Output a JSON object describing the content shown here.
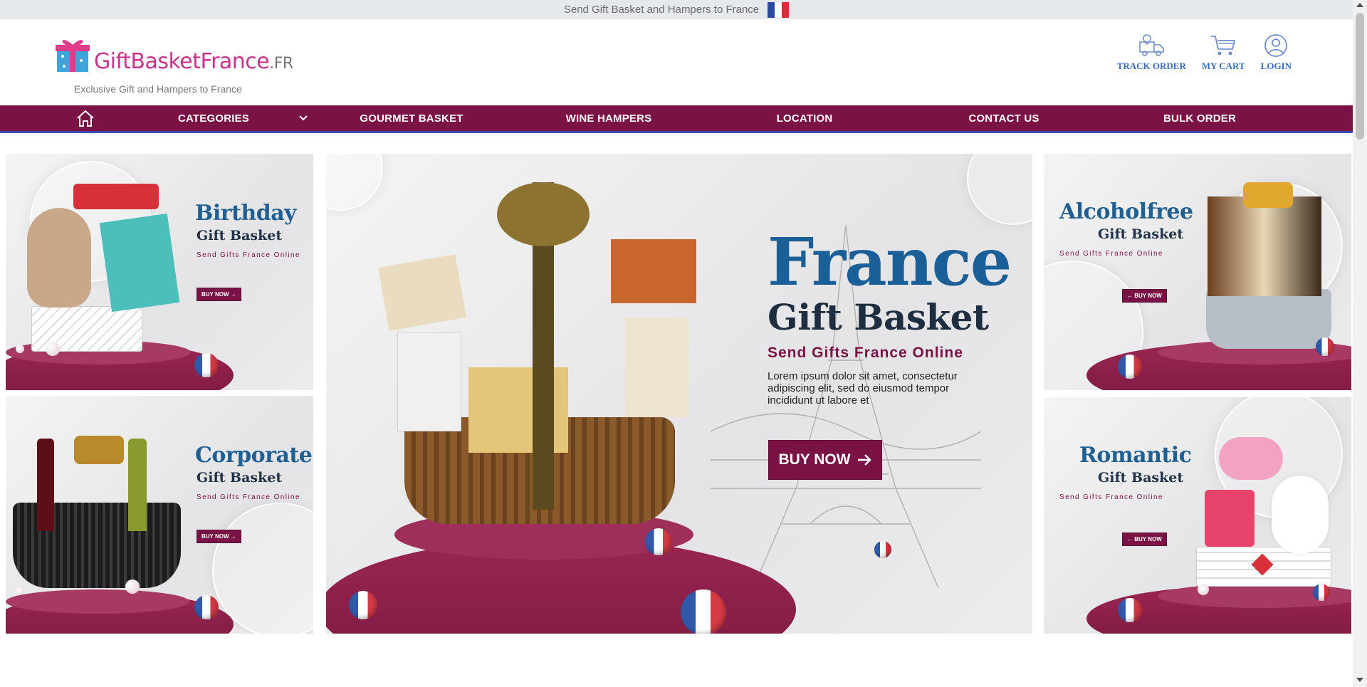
{
  "topbar": {
    "text": "Send Gift Basket and Hampers to France",
    "flag_colors": [
      "#2a49a0",
      "#ffffff",
      "#d8303a"
    ]
  },
  "header": {
    "logo_main": "GiftBasketFrance",
    "logo_suffix": ".FR",
    "tagline": "Exclusive Gift and Hampers to France",
    "icons": [
      {
        "label": "TRACK ORDER",
        "icon": "truck-icon"
      },
      {
        "label": "MY CART",
        "icon": "cart-icon"
      },
      {
        "label": "LOGIN",
        "icon": "user-icon"
      }
    ]
  },
  "nav": {
    "home_icon": "home-icon",
    "items": [
      "CATEGORIES",
      "GOURMET BASKET",
      "WINE HAMPERS",
      "LOCATION",
      "CONTACT US",
      "BULK ORDER"
    ]
  },
  "banners": {
    "birthday": {
      "title": "Birthday",
      "subtitle": "Gift Basket",
      "tagline": "Send Gifts France Online",
      "button": "BUY NOW"
    },
    "corporate": {
      "title": "Corporate",
      "subtitle": "Gift Basket",
      "tagline": "Send Gifts France Online",
      "button": "BUY NOW"
    },
    "alcoholfree": {
      "title": "Alcoholfree",
      "subtitle": "Gift Basket",
      "tagline": "Send Gifts France Online",
      "button": "BUY NOW"
    },
    "romantic": {
      "title": "Romantic",
      "subtitle": "Gift Basket",
      "tagline": "Send Gifts France Online",
      "button": "BUY NOW"
    },
    "hero": {
      "title": "France",
      "subtitle": "Gift Basket",
      "tagline": "Send Gifts France Online",
      "description": "Lorem ipsum dolor sit amet, consectetur adipiscing elit, sed do eiusmod tempor incididunt ut labore et",
      "button": "BUY NOW"
    }
  },
  "colors": {
    "brand": "#7b1246",
    "title_blue": "#1a5f97",
    "nav_bg": "#7b1246",
    "icon_blue": "#3a6fb8"
  }
}
